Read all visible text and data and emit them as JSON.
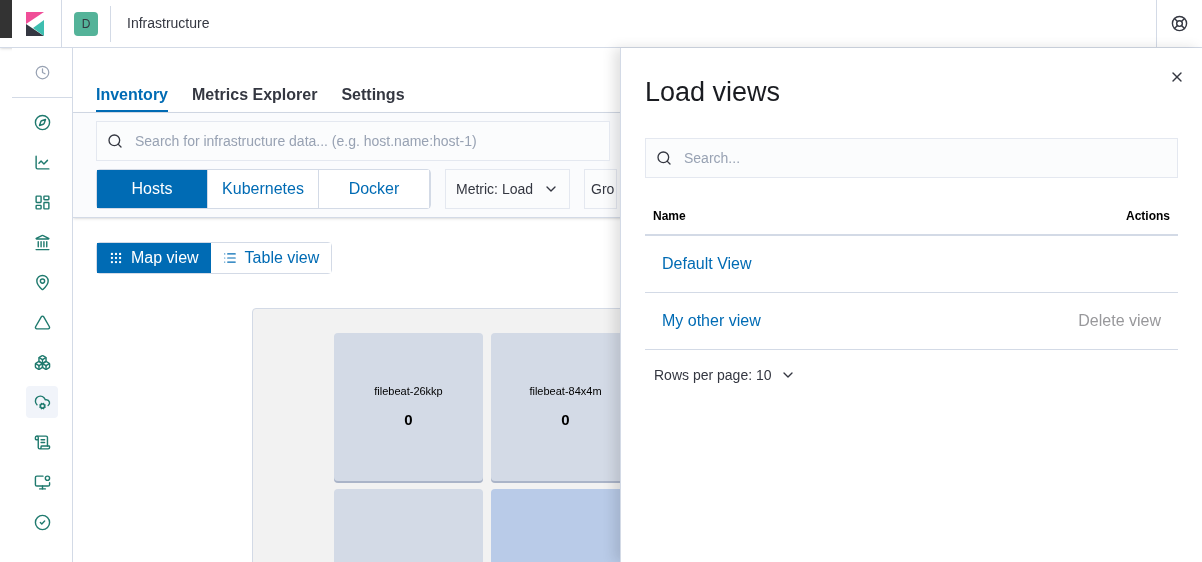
{
  "header": {
    "space_avatar": "D",
    "title": "Infrastructure"
  },
  "nav_items": [
    {
      "selected": false
    },
    {
      "selected": false
    },
    {
      "selected": false
    },
    {
      "selected": false
    },
    {
      "selected": false
    },
    {
      "selected": false
    },
    {
      "selected": false
    },
    {
      "selected": true
    },
    {
      "selected": false
    },
    {
      "selected": false
    },
    {
      "selected": false
    }
  ],
  "tabs": [
    {
      "label": "Inventory",
      "selected": true
    },
    {
      "label": "Metrics Explorer",
      "selected": false
    },
    {
      "label": "Settings",
      "selected": false
    }
  ],
  "search": {
    "placeholder": "Search for infrastructure data... (e.g. host.name:host-1)"
  },
  "node_types": [
    {
      "label": "Hosts",
      "selected": true
    },
    {
      "label": "Kubernetes",
      "selected": false
    },
    {
      "label": "Docker",
      "selected": false
    }
  ],
  "metric_select": "Metric: Load",
  "group_select": "Gro",
  "view_toggle": [
    {
      "label": "Map view",
      "selected": true,
      "kind": "map"
    },
    {
      "label": "Table view",
      "selected": false,
      "kind": "table"
    }
  ],
  "tiles": [
    {
      "name": "filebeat-26kkp",
      "value": "0",
      "color": "#d3dae6"
    },
    {
      "name": "filebeat-84x4m",
      "value": "0",
      "color": "#d3dae6"
    },
    {
      "color": "#d3dae6"
    },
    {
      "color": "#b9cbe8"
    }
  ],
  "flyout": {
    "title": "Load views",
    "search_placeholder": "Search...",
    "columns": [
      "Name",
      "Actions"
    ],
    "rows": [
      {
        "name": "Default View"
      },
      {
        "name": "My other view",
        "action": "Delete view"
      }
    ],
    "rows_per_page": "Rows per page: 10"
  }
}
